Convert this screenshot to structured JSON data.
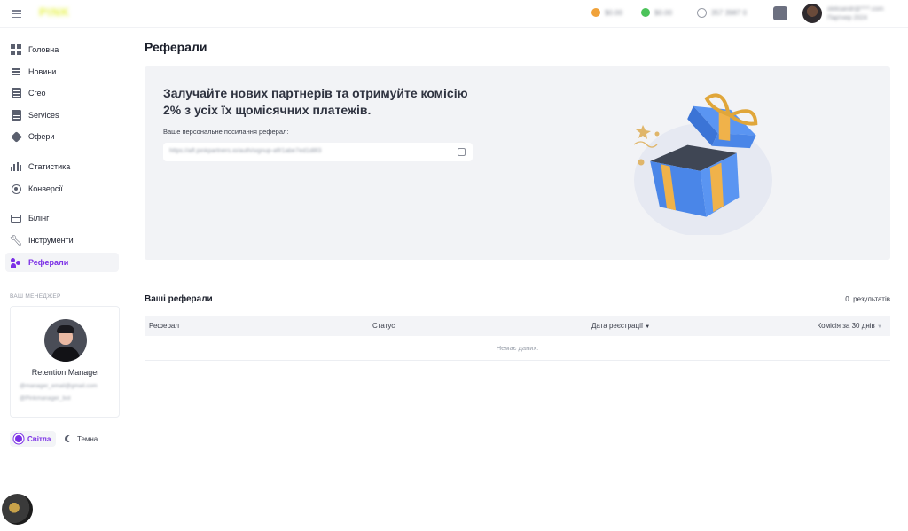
{
  "topbar": {
    "stat1": "$0.00",
    "stat2": "$0.00",
    "stat3": "357 3987 0",
    "user_name": "oleksandr@****.com",
    "user_role": "Партнер 2024",
    "stat1_color": "#f0a23a",
    "stat2_color": "#4cc35a"
  },
  "sidebar": {
    "items": [
      {
        "label": "Головна",
        "icon": "dashboard-icon"
      },
      {
        "label": "Новини",
        "icon": "news-icon"
      },
      {
        "label": "Creo",
        "icon": "document-icon"
      },
      {
        "label": "Services",
        "icon": "document-icon"
      },
      {
        "label": "Офери",
        "icon": "tag-icon"
      },
      {
        "label": "Статистика",
        "icon": "bar-chart-icon"
      },
      {
        "label": "Конверсії",
        "icon": "target-icon"
      },
      {
        "label": "Білінг",
        "icon": "credit-card-icon"
      },
      {
        "label": "Інструменти",
        "icon": "wrench-icon"
      },
      {
        "label": "Реферали",
        "icon": "referral-icon",
        "active": true
      }
    ],
    "manager_title": "ВАШ МЕНЕДЖЕР",
    "manager_name": "Retention Manager",
    "manager_email": "@manager_email@gmail.com",
    "manager_telegram": "@Pinkmanager_bot",
    "theme_light": "Світла",
    "theme_dark": "Темна",
    "accent_color": "#7b2fe6"
  },
  "main": {
    "page_title": "Реферали",
    "banner_heading": "Залучайте нових партнерів та отримуйте комісію 2% з усіх їх щомісячних платежів.",
    "banner_label": "Ваше персональне посилання реферал:",
    "referral_link": "https://aff.pinkpartners.io/auth/signup-aff/1abe7ed1d8f3",
    "referrals_title": "Ваші реферали",
    "results_count": "0",
    "results_label": "результатів",
    "table": {
      "columns": [
        "Реферал",
        "Статус",
        "Дата реєстрації",
        "Комісія за 30 днів"
      ],
      "empty_text": "Немає даних."
    }
  }
}
